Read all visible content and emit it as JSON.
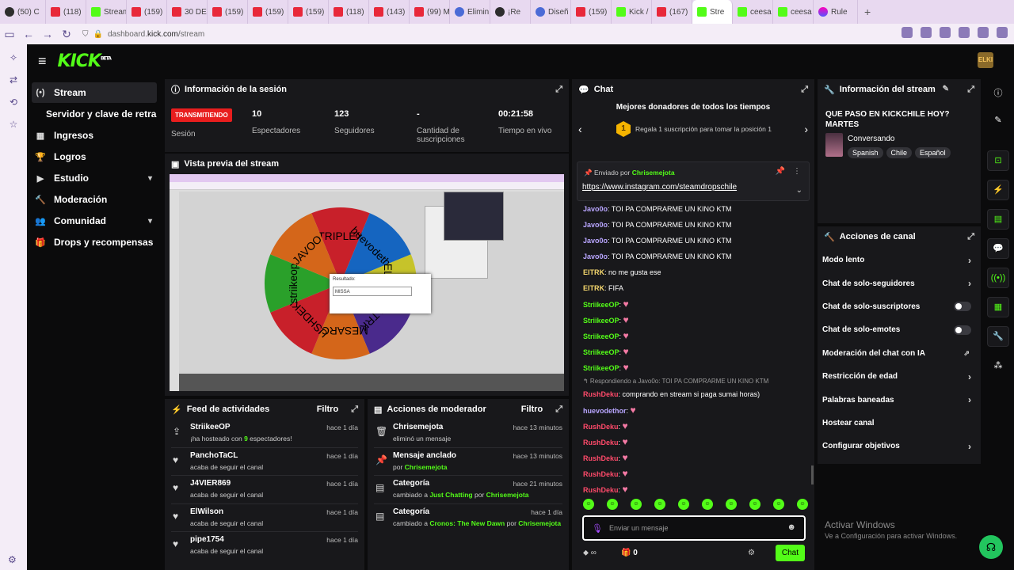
{
  "browser": {
    "tabs": [
      {
        "icon": "gl",
        "label": "(50) C"
      },
      {
        "icon": "yt",
        "label": "(118)"
      },
      {
        "icon": "kk",
        "label": "Stream"
      },
      {
        "icon": "yt",
        "label": "(159)"
      },
      {
        "icon": "yt",
        "label": "30 DE"
      },
      {
        "icon": "yt",
        "label": "(159)"
      },
      {
        "icon": "yt",
        "label": "(159)"
      },
      {
        "icon": "yt",
        "label": "(159)"
      },
      {
        "icon": "yt",
        "label": "(118)"
      },
      {
        "icon": "yt",
        "label": "(143)"
      },
      {
        "icon": "yt",
        "label": "(99) M"
      },
      {
        "icon": "bl",
        "label": "Elimin"
      },
      {
        "icon": "gl",
        "label": "¡Re"
      },
      {
        "icon": "bl",
        "label": "Diseñ"
      },
      {
        "icon": "yt",
        "label": "(159)"
      },
      {
        "icon": "kk",
        "label": "Kick /"
      },
      {
        "icon": "yt",
        "label": "(167)"
      },
      {
        "icon": "kk",
        "label": "Stre",
        "active": true
      },
      {
        "icon": "kk",
        "label": "ceesa"
      },
      {
        "icon": "kk",
        "label": "ceesa"
      },
      {
        "icon": "pg",
        "label": "Rule"
      }
    ],
    "url_prefix": "dashboard.",
    "url_host": "kick.com",
    "url_path": "/stream"
  },
  "header": {
    "logo": "KICK",
    "beta": "BETA",
    "avatar_text": "ELKI"
  },
  "nav": [
    {
      "icon": "(•)",
      "label": "Stream",
      "active": true
    },
    {
      "icon": "",
      "label": "Servidor y clave de retransm",
      "sub": true
    },
    {
      "icon": "▦",
      "label": "Ingresos"
    },
    {
      "icon": "🏆",
      "label": "Logros"
    },
    {
      "icon": "▶",
      "label": "Estudio",
      "chev": "▾"
    },
    {
      "icon": "🔨",
      "label": "Moderación"
    },
    {
      "icon": "👥",
      "label": "Comunidad",
      "chev": "▾"
    },
    {
      "icon": "🎁",
      "label": "Drops y recompensas"
    }
  ],
  "session": {
    "title": "Información de la sesión",
    "live": "TRANSMITIENDO",
    "session_label": "Sesión",
    "stats": [
      {
        "value": "10",
        "label": "Espectadores"
      },
      {
        "value": "123",
        "label": "Seguidores"
      },
      {
        "value": "-",
        "label": "Cantidad de suscripciones"
      },
      {
        "value": "00:21:58",
        "label": "Tiempo en vivo"
      }
    ]
  },
  "preview": {
    "title": "Vista previa del stream",
    "wheel_names": [
      "TRIPLEX",
      "huevodethor",
      "ELIPRO",
      "ELTRK",
      "MESARCO",
      "USHDEKU",
      "striikeop",
      "JAVOO"
    ],
    "wheel_colors": [
      "#c8202a",
      "#1565c0",
      "#c6c32a",
      "#4a2a8c",
      "#d4661a",
      "#c8202a",
      "#2aa02a",
      "#d4661a"
    ],
    "dialog_label": "Resultado:",
    "dialog_value": "MISSA"
  },
  "feed": {
    "title": "Feed de actividades",
    "filter": "Filtro",
    "items": [
      {
        "icon": "⇪",
        "name": "StriikeeOP",
        "pre": "¡ha hosteado con ",
        "hl": "9",
        "post": " espectadores!",
        "time": "hace 1 día"
      },
      {
        "icon": "♥",
        "name": "PanchoTaCL",
        "pre": "acaba de seguir el canal",
        "hl": "",
        "post": "",
        "time": "hace 1 día"
      },
      {
        "icon": "♥",
        "name": "J4VIER869",
        "pre": "acaba de seguir el canal",
        "hl": "",
        "post": "",
        "time": "hace 1 día"
      },
      {
        "icon": "♥",
        "name": "ElWilson",
        "pre": "acaba de seguir el canal",
        "hl": "",
        "post": "",
        "time": "hace 1 día"
      },
      {
        "icon": "♥",
        "name": "pipe1754",
        "pre": "acaba de seguir el canal",
        "hl": "",
        "post": "",
        "time": "hace 1 día"
      }
    ]
  },
  "modactions": {
    "title": "Acciones de moderador",
    "filter": "Filtro",
    "items": [
      {
        "icon": "🗑",
        "name": "Chrisemejota",
        "pre": "eliminó un mensaje",
        "hl": "",
        "post": "",
        "hl2": "",
        "time": "hace 13 minutos"
      },
      {
        "icon": "📌",
        "name": "Mensaje anclado",
        "pre": "por ",
        "hl": "Chrisemejota",
        "post": "",
        "hl2": "",
        "time": "hace 13 minutos"
      },
      {
        "icon": "▤",
        "name": "Categoría",
        "pre": "cambiado a ",
        "hl": "Just Chatting",
        "post": " por ",
        "hl2": "Chrisemejota",
        "time": "hace 21 minutos"
      },
      {
        "icon": "▤",
        "name": "Categoría",
        "pre": "cambiado a ",
        "hl": "Cronos: The New Dawn",
        "post": " por ",
        "hl2": "Chrisemejota",
        "time": "hace 1 día"
      }
    ]
  },
  "chat": {
    "title": "Chat",
    "donors_title": "Mejores donadores de todos los tiempos",
    "rank": "1",
    "donors_text": "Regala 1 suscripción para tomar la posición 1",
    "pinned_by_label": "Enviado por",
    "pinned_by": "Chrisemejota",
    "pinned_link": "https://www.instagram.com/steamdropschile",
    "messages": [
      {
        "user": "Javo0o",
        "color": "#b9a6ff",
        "text": "TOI PA COMPRARME UN KINO KTM"
      },
      {
        "user": "Javo0o",
        "color": "#b9a6ff",
        "text": "TOI PA COMPRARME UN KINO KTM"
      },
      {
        "user": "Javo0o",
        "color": "#b9a6ff",
        "text": "TOI PA COMPRARME UN KINO KTM"
      },
      {
        "user": "Javo0o",
        "color": "#b9a6ff",
        "text": "TOI PA COMPRARME UN KINO KTM"
      },
      {
        "user": "EITRK",
        "color": "#f5d76e",
        "text": "no me gusta ese"
      },
      {
        "user": "EITRK",
        "color": "#f5d76e",
        "text": "FIFA"
      },
      {
        "user": "StriikeeOP",
        "color": "#53fc18",
        "text": "",
        "heart": true
      },
      {
        "user": "StriikeeOP",
        "color": "#53fc18",
        "text": "",
        "heart": true
      },
      {
        "user": "StriikeeOP",
        "color": "#53fc18",
        "text": "",
        "heart": true
      },
      {
        "user": "StriikeeOP",
        "color": "#53fc18",
        "text": "",
        "heart": true
      },
      {
        "user": "StriikeeOP",
        "color": "#53fc18",
        "text": "",
        "heart": true
      }
    ],
    "reply_note": "↰ Respondiendo a Javo0o: TOI PA COMPRARME UN KINO KTM",
    "messages2": [
      {
        "user": "RushDeku",
        "color": "#ff4a6a",
        "text": "comprando en stream si paga sumai horas)"
      },
      {
        "user": "huevodethor",
        "color": "#b9a6ff",
        "text": "",
        "heart": true
      },
      {
        "user": "RushDeku",
        "color": "#ff4a6a",
        "text": "",
        "heart": true
      },
      {
        "user": "RushDeku",
        "color": "#ff4a6a",
        "text": "",
        "heart": true
      },
      {
        "user": "RushDeku",
        "color": "#ff4a6a",
        "text": "",
        "heart": true
      },
      {
        "user": "RushDeku",
        "color": "#ff4a6a",
        "text": "",
        "heart": true
      },
      {
        "user": "RushDeku",
        "color": "#ff4a6a",
        "text": "",
        "heart": true
      }
    ],
    "input_placeholder": "Enviar un mensaje",
    "points": "∞",
    "boxes": "0",
    "send_label": "Chat"
  },
  "stream_info": {
    "title": "Información del stream",
    "stream_title": "QUE PASO EN KICKCHILE HOY? MARTES",
    "category": "Conversando",
    "tags": [
      "Spanish",
      "Chile",
      "Español"
    ]
  },
  "channel_actions": {
    "title": "Acciones de canal",
    "items": [
      {
        "label": "Modo lento",
        "type": "chev"
      },
      {
        "label": "Chat de solo-seguidores",
        "type": "chev"
      },
      {
        "label": "Chat de solo-suscriptores",
        "type": "toggle"
      },
      {
        "label": "Chat de solo-emotes",
        "type": "toggle"
      },
      {
        "label": "Moderación del chat con IA",
        "type": "ext"
      },
      {
        "label": "Restricción de edad",
        "type": "chev"
      },
      {
        "label": "Palabras baneadas",
        "type": "chev"
      },
      {
        "label": "Hostear canal",
        "type": "none"
      },
      {
        "label": "Configurar objetivos",
        "type": "chev"
      }
    ]
  },
  "windows": {
    "line1": "Activar Windows",
    "line2": "Ve a Configuración para activar Windows."
  }
}
